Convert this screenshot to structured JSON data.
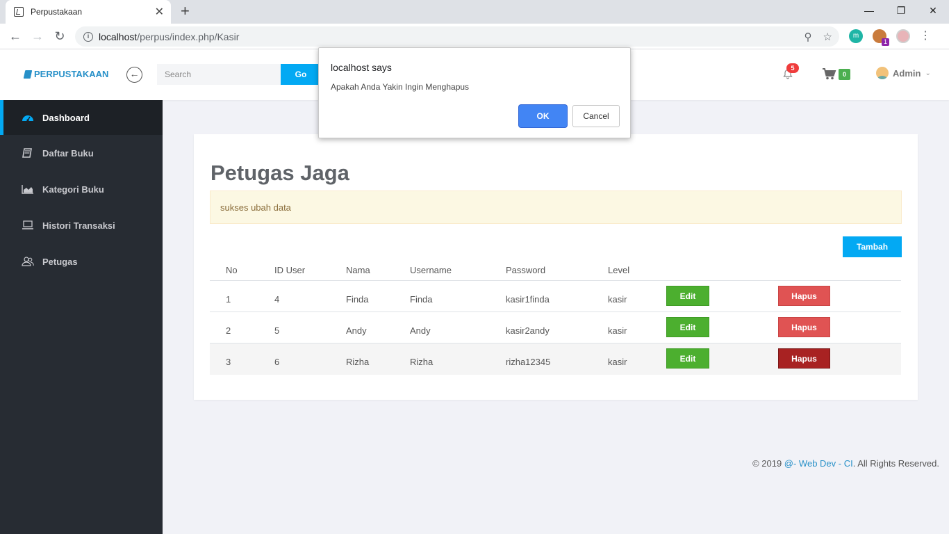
{
  "browser": {
    "tab_title": "Perpustakaan",
    "url_host": "localhost",
    "url_path": "/perpus/index.php/Kasir",
    "extension_badge": "1"
  },
  "header": {
    "brand": "PERPUSTAKAAN",
    "search_placeholder": "Search",
    "search_button": "Go",
    "notification_count": "5",
    "cart_count": "0",
    "user_name": "Admin"
  },
  "sidebar": {
    "items": [
      {
        "label": "Dashboard",
        "icon": "dashboard-icon"
      },
      {
        "label": "Daftar Buku",
        "icon": "book-icon"
      },
      {
        "label": "Kategori Buku",
        "icon": "area-chart-icon"
      },
      {
        "label": "Histori Transaksi",
        "icon": "laptop-icon"
      },
      {
        "label": "Petugas",
        "icon": "users-icon"
      }
    ]
  },
  "main": {
    "title": "Petugas Jaga",
    "alert": "sukses ubah data",
    "add_button": "Tambah",
    "columns": [
      "No",
      "ID User",
      "Nama",
      "Username",
      "Password",
      "Level"
    ],
    "rows": [
      {
        "no": "1",
        "id": "4",
        "nama": "Finda",
        "username": "Finda",
        "password": "kasir1finda",
        "level": "kasir"
      },
      {
        "no": "2",
        "id": "5",
        "nama": "Andy",
        "username": "Andy",
        "password": "kasir2andy",
        "level": "kasir"
      },
      {
        "no": "3",
        "id": "6",
        "nama": "Rizha",
        "username": "Rizha",
        "password": "rizha12345",
        "level": "kasir"
      }
    ],
    "edit_label": "Edit",
    "delete_label": "Hapus"
  },
  "footer": {
    "prefix": "© 2019 ",
    "link": "@- Web Dev - CI",
    "suffix": ". All Rights Reserved."
  },
  "dialog": {
    "title": "localhost says",
    "message": "Apakah Anda Yakin Ingin Menghapus",
    "ok": "OK",
    "cancel": "Cancel"
  }
}
